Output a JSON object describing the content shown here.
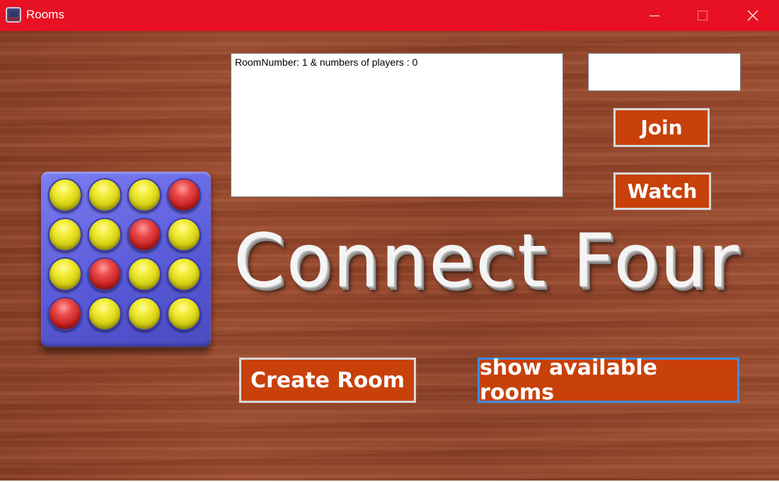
{
  "window": {
    "title": "Rooms",
    "controls": {
      "minimize": "minimize-icon",
      "maximize": "maximize-icon",
      "close": "close-icon"
    }
  },
  "rooms_list": {
    "items": [
      "RoomNumber: 1 & numbers of players : 0"
    ]
  },
  "room_input": {
    "value": ""
  },
  "buttons": {
    "join": "Join",
    "watch": "Watch",
    "create_room": "Create Room",
    "show_available_rooms": "show available rooms"
  },
  "logo": {
    "title": "Connect Four",
    "board": [
      [
        "yellow",
        "yellow",
        "yellow",
        "red"
      ],
      [
        "yellow",
        "yellow",
        "red",
        "yellow"
      ],
      [
        "yellow",
        "red",
        "yellow",
        "yellow"
      ],
      [
        "red",
        "yellow",
        "yellow",
        "yellow"
      ]
    ]
  },
  "colors": {
    "titlebar": "#e81123",
    "button_bg": "#c8410a",
    "board": "#5758d6"
  }
}
